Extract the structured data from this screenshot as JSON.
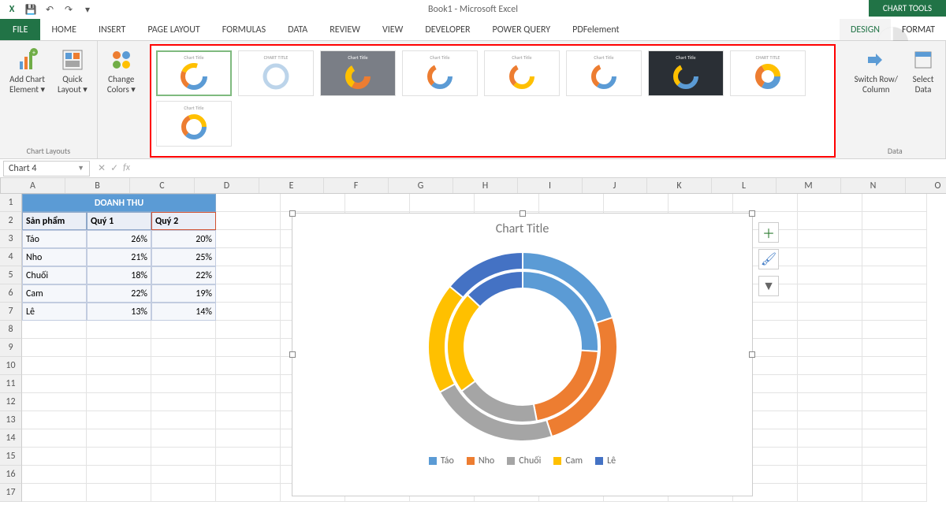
{
  "app": {
    "title": "Book1 - Microsoft Excel",
    "chart_tools": "CHART TOOLS"
  },
  "tabs": {
    "file": "FILE",
    "home": "HOME",
    "insert": "INSERT",
    "page_layout": "PAGE LAYOUT",
    "formulas": "FORMULAS",
    "data": "DATA",
    "review": "REVIEW",
    "view": "VIEW",
    "developer": "DEVELOPER",
    "power_query": "POWER QUERY",
    "pdf": "PDFelement",
    "design": "DESIGN",
    "format": "FORMAT"
  },
  "ribbon": {
    "add_chart_element": "Add Chart\nElement ▾",
    "quick_layout": "Quick\nLayout ▾",
    "chart_layouts": "Chart Layouts",
    "change_colors": "Change\nColors ▾",
    "switch_rc": "Switch Row/\nColumn",
    "select_data": "Select\nData",
    "data_group": "Data"
  },
  "namebox": "Chart 4",
  "columns": [
    "A",
    "B",
    "C",
    "D",
    "E",
    "F",
    "G",
    "H",
    "I",
    "J",
    "K",
    "L",
    "M",
    "N",
    "O"
  ],
  "rows": [
    1,
    2,
    3,
    4,
    5,
    6,
    7,
    8,
    9,
    10,
    11,
    12,
    13,
    14,
    15,
    16,
    17
  ],
  "sheet": {
    "title": "DOANH THU",
    "headers": {
      "a": "Sản phẩm",
      "b": "Quý 1",
      "c": "Quý 2"
    },
    "rows": [
      {
        "a": "Táo",
        "b": "26%",
        "c": "20%"
      },
      {
        "a": "Nho",
        "b": "21%",
        "c": "25%"
      },
      {
        "a": "Chuối",
        "b": "18%",
        "c": "22%"
      },
      {
        "a": "Cam",
        "b": "22%",
        "c": "19%"
      },
      {
        "a": "Lê",
        "b": "13%",
        "c": "14%"
      }
    ]
  },
  "chart": {
    "title": "Chart Title",
    "legend": [
      "Táo",
      "Nho",
      "Chuối",
      "Cam",
      "Lê"
    ],
    "colors": {
      "tao": "#5b9bd5",
      "nho": "#ed7d31",
      "chuoi": "#a5a5a5",
      "cam": "#ffc000",
      "le": "#4472c4"
    }
  },
  "chart_data": {
    "type": "pie",
    "title": "Chart Title",
    "note": "double-ring donut; inner=Quý 1, outer=Quý 2, percentages by product",
    "categories": [
      "Táo",
      "Nho",
      "Chuối",
      "Cam",
      "Lê"
    ],
    "series": [
      {
        "name": "Quý 1",
        "values": [
          26,
          21,
          18,
          22,
          13
        ]
      },
      {
        "name": "Quý 2",
        "values": [
          20,
          25,
          22,
          19,
          14
        ]
      }
    ],
    "colors": [
      "#5b9bd5",
      "#ed7d31",
      "#a5a5a5",
      "#ffc000",
      "#4472c4"
    ]
  }
}
